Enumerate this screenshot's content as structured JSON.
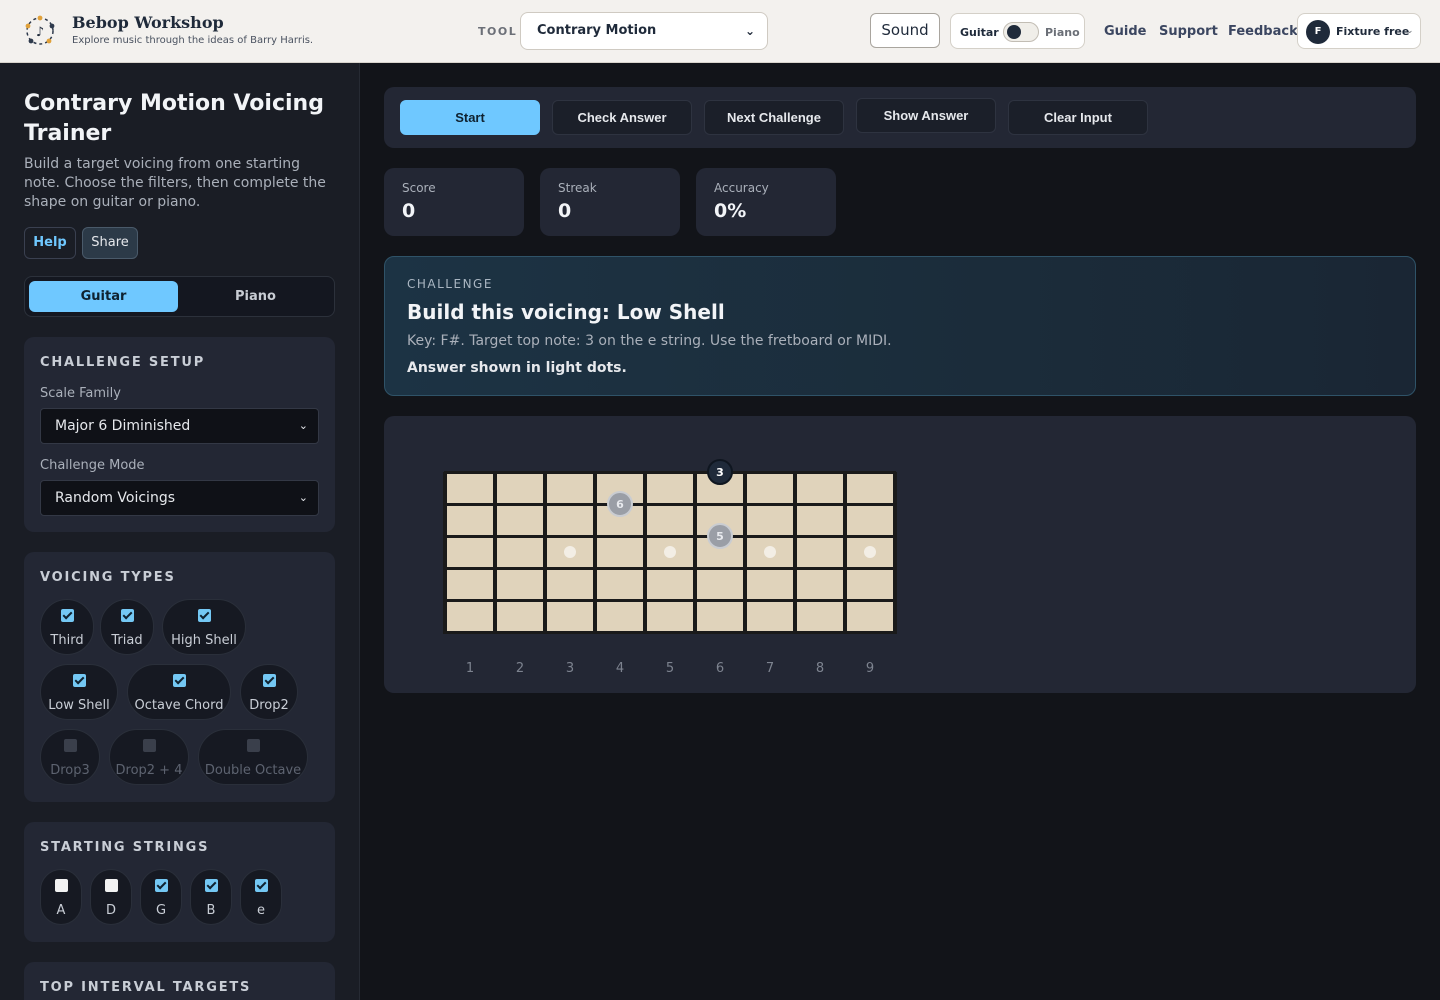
{
  "header": {
    "brand_title": "Bebop Workshop",
    "brand_subtitle": "Explore music through the ideas of Barry Harris.",
    "tool_label": "TOOL",
    "tool_selected": "Contrary Motion",
    "sound_label": "Sound",
    "toggle_left": "Guitar",
    "toggle_right": "Piano",
    "nav": [
      "Guide",
      "Support",
      "Feedback"
    ],
    "user_initial": "F",
    "user_label": "Fixture free"
  },
  "sidebar": {
    "title": "Contrary Motion Voicing Trainer",
    "description": "Build a target voicing from one starting note. Choose the filters, then complete the shape on guitar or piano.",
    "help_label": "Help",
    "share_label": "Share",
    "instrument_options": [
      "Guitar",
      "Piano"
    ],
    "instrument_selected": "Guitar",
    "setup": {
      "heading": "CHALLENGE SETUP",
      "scale_family_label": "Scale Family",
      "scale_family_value": "Major 6 Diminished",
      "mode_label": "Challenge Mode",
      "mode_value": "Random Voicings"
    },
    "voicing_types": {
      "heading": "VOICING TYPES",
      "items": [
        {
          "label": "Third",
          "checked": true,
          "enabled": true
        },
        {
          "label": "Triad",
          "checked": true,
          "enabled": true
        },
        {
          "label": "High Shell",
          "checked": true,
          "enabled": true
        },
        {
          "label": "Low Shell",
          "checked": true,
          "enabled": true
        },
        {
          "label": "Octave Chord",
          "checked": true,
          "enabled": true
        },
        {
          "label": "Drop2",
          "checked": true,
          "enabled": true
        },
        {
          "label": "Drop3",
          "checked": false,
          "enabled": false
        },
        {
          "label": "Drop2 + 4",
          "checked": false,
          "enabled": false
        },
        {
          "label": "Double Octave",
          "checked": false,
          "enabled": false
        }
      ]
    },
    "starting_strings": {
      "heading": "STARTING STRINGS",
      "items": [
        {
          "label": "A",
          "checked": false
        },
        {
          "label": "D",
          "checked": false
        },
        {
          "label": "G",
          "checked": true
        },
        {
          "label": "B",
          "checked": true
        },
        {
          "label": "e",
          "checked": true
        }
      ]
    },
    "top_interval": {
      "heading": "TOP INTERVAL TARGETS"
    }
  },
  "toolbar": {
    "start": "Start",
    "check": "Check Answer",
    "next": "Next Challenge",
    "show": "Show Answer",
    "clear": "Clear Input"
  },
  "stats": [
    {
      "label": "Score",
      "value": "0"
    },
    {
      "label": "Streak",
      "value": "0"
    },
    {
      "label": "Accuracy",
      "value": "0%"
    }
  ],
  "challenge": {
    "eyebrow": "CHALLENGE",
    "title": "Build this voicing: Low Shell",
    "body": "Key: F#. Target top note: 3 on the e string. Use the fretboard or MIDI.",
    "note": "Answer shown in light dots."
  },
  "fretboard": {
    "frets": [
      "1",
      "2",
      "3",
      "4",
      "5",
      "6",
      "7",
      "8",
      "9"
    ],
    "string_count": 6,
    "inlay_frets": [
      3,
      5,
      7,
      9
    ],
    "notes": [
      {
        "label": "3",
        "string": 1,
        "fret": 6,
        "style": "target"
      },
      {
        "label": "6",
        "string": 2,
        "fret": 4,
        "style": "answer"
      },
      {
        "label": "5",
        "string": 3,
        "fret": 6,
        "style": "answer"
      }
    ],
    "colors": {
      "wood": "#e0d3bb",
      "fret": "#1a1a1a",
      "target": "#1f2a3a",
      "answer": "#9a9ea6"
    }
  }
}
